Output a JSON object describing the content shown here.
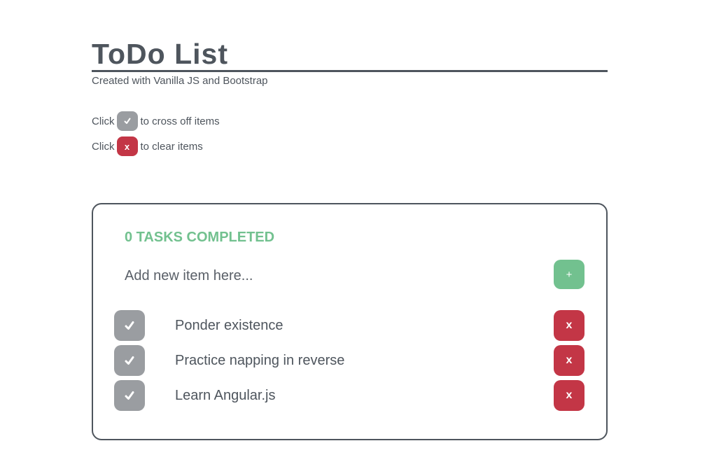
{
  "header": {
    "title": "ToDo List",
    "subtitle": "Created with Vanilla JS and Bootstrap"
  },
  "instructions": {
    "row1_prefix": "Click",
    "row1_suffix": "to cross off items",
    "row2_prefix": "Click",
    "row2_icon_label": "x",
    "row2_suffix": "to clear items"
  },
  "card": {
    "completed_text": "0 TASKS COMPLETED",
    "add_placeholder": "Add new item here...",
    "add_button_label": "+",
    "delete_label": "x",
    "items": [
      {
        "text": "Ponder existence"
      },
      {
        "text": "Practice napping in reverse"
      },
      {
        "text": "Learn Angular.js"
      }
    ]
  },
  "colors": {
    "text": "#4e555d",
    "check_gray": "#9a9da1",
    "delete_red": "#c33646",
    "success_green": "#72c18f"
  },
  "icons": {
    "check": "check-icon",
    "delete": "close-icon",
    "add": "plus-icon"
  }
}
